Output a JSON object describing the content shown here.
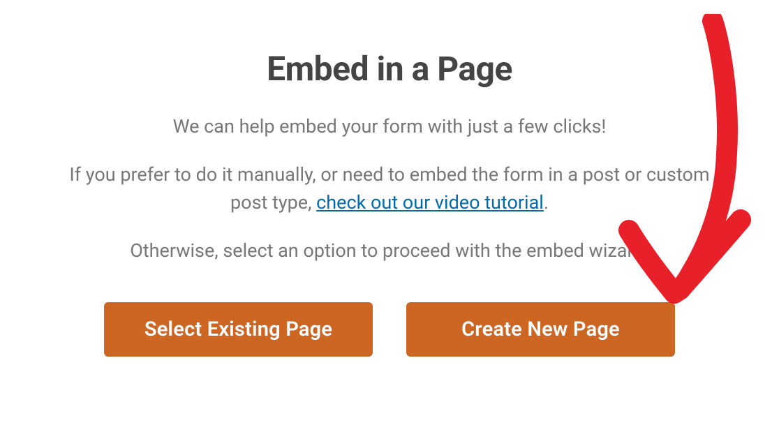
{
  "modal": {
    "title": "Embed in a Page",
    "description": {
      "line1": "We can help embed your form with just a few clicks!",
      "line2_prefix": "If you prefer to do it manually, or need to embed the form in a post or custom post type, ",
      "link_text": "check out our video tutorial",
      "line2_suffix": ".",
      "line3": "Otherwise, select an option to proceed with the embed wizard."
    },
    "buttons": {
      "select_existing": "Select Existing Page",
      "create_new": "Create New Page"
    }
  },
  "annotation": {
    "arrow_color": "#e8202a"
  }
}
